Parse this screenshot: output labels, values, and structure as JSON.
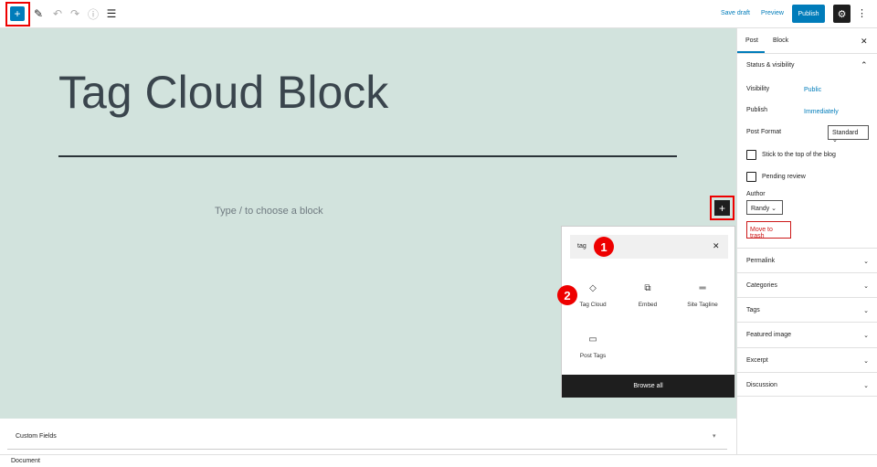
{
  "toolbar": {
    "add_icon": "+",
    "save_draft": "Save draft",
    "preview": "Preview",
    "publish": "Publish"
  },
  "editor": {
    "title": "Tag Cloud Block",
    "placeholder": "Type / to choose a block"
  },
  "inserter": {
    "search_value": "tag",
    "items": [
      {
        "label": "Tag Cloud",
        "icon": "tag-icon"
      },
      {
        "label": "Embed",
        "icon": "embed-icon"
      },
      {
        "label": "Site Tagline",
        "icon": "tagline-icon"
      },
      {
        "label": "Post Tags",
        "icon": "post-tags-icon"
      }
    ],
    "browse_all": "Browse all"
  },
  "annotations": [
    "1",
    "2"
  ],
  "sidebar": {
    "tabs": [
      "Post",
      "Block"
    ],
    "status_title": "Status & visibility",
    "visibility_label": "Visibility",
    "visibility_value": "Public",
    "publish_label": "Publish",
    "publish_value": "Immediately",
    "format_label": "Post Format",
    "format_value": "Standard",
    "stick": "Stick to the top of the blog",
    "pending": "Pending review",
    "author_label": "Author",
    "author_value": "Randy",
    "trash": "Move to trash",
    "panels": [
      "Permalink",
      "Categories",
      "Tags",
      "Featured image",
      "Excerpt",
      "Discussion"
    ]
  },
  "footer": {
    "custom_fields": "Custom Fields",
    "breadcrumb": "Document"
  }
}
